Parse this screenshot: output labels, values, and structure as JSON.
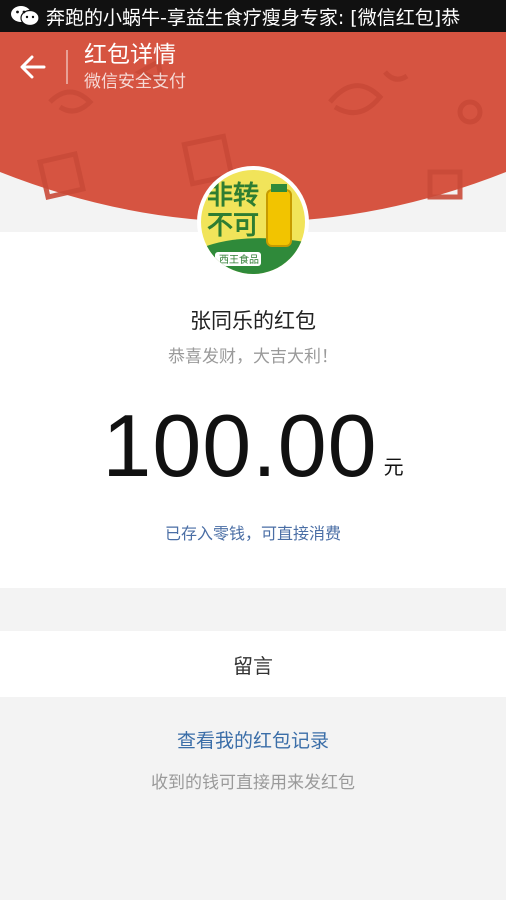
{
  "notification": {
    "icon": "wechat-icon",
    "text": "奔跑的小蜗牛-享益生食疗瘦身专家: [微信红包]恭"
  },
  "header": {
    "title": "红包详情",
    "subtitle": "微信安全支付",
    "back_icon": "back-arrow-icon",
    "color": "#d65441"
  },
  "sender": {
    "avatar_text_top": "非转",
    "avatar_text_bottom": "不可",
    "avatar_brand": "西王食品",
    "name": "张同乐的红包",
    "blessing": "恭喜发财，大吉大利！"
  },
  "amount": {
    "value": "100.00",
    "unit": "元"
  },
  "status": "已存入零钱，可直接消费",
  "message_label": "留言",
  "records_link": "查看我的红包记录",
  "hint": "收到的钱可直接用来发红包"
}
